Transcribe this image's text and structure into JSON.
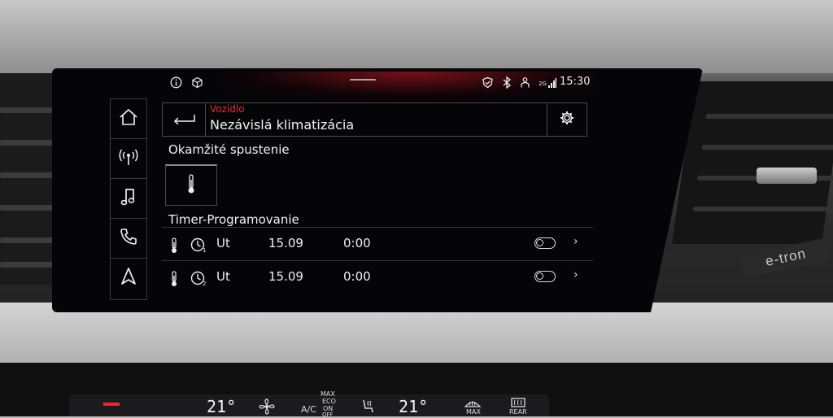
{
  "status_bar": {
    "icons": [
      "info-icon",
      "cube-icon",
      "shield-icon",
      "bluetooth-icon",
      "person-icon",
      "signal-icon"
    ],
    "network": "2G",
    "time": "15:30"
  },
  "sidebar": {
    "items": [
      {
        "name": "home",
        "icon": "home-icon"
      },
      {
        "name": "car-connect",
        "icon": "antenna-icon"
      },
      {
        "name": "media",
        "icon": "music-note-icon"
      },
      {
        "name": "phone",
        "icon": "phone-icon"
      },
      {
        "name": "navigation",
        "icon": "navigation-arrow-icon"
      }
    ]
  },
  "header": {
    "breadcrumb": "Vozidlo",
    "title": "Nezávislá klimatizácia"
  },
  "instant_section": {
    "title": "Okamžité spustenie"
  },
  "timer_section": {
    "title": "Timer-Programovanie",
    "rows": [
      {
        "timer_index": "1",
        "day": "Ut",
        "date": "15.09",
        "time": "0:00",
        "enabled": false
      },
      {
        "timer_index": "2",
        "day": "Ut",
        "date": "15.09",
        "time": "0:00",
        "enabled": false
      }
    ]
  },
  "climate_console": {
    "left_temp": "21°",
    "right_temp": "21°",
    "ac_label": "A/C",
    "max_label": "MAX",
    "eco_label": "ECO",
    "on_label": "ON",
    "off_label": "OFF",
    "defrost_max_label": "MAX",
    "rear_label": "REAR"
  },
  "car_badge": "e-tron",
  "colors": {
    "accent_red": "#e0302e",
    "screen_bg": "#050507",
    "text": "#f2f2f2"
  }
}
